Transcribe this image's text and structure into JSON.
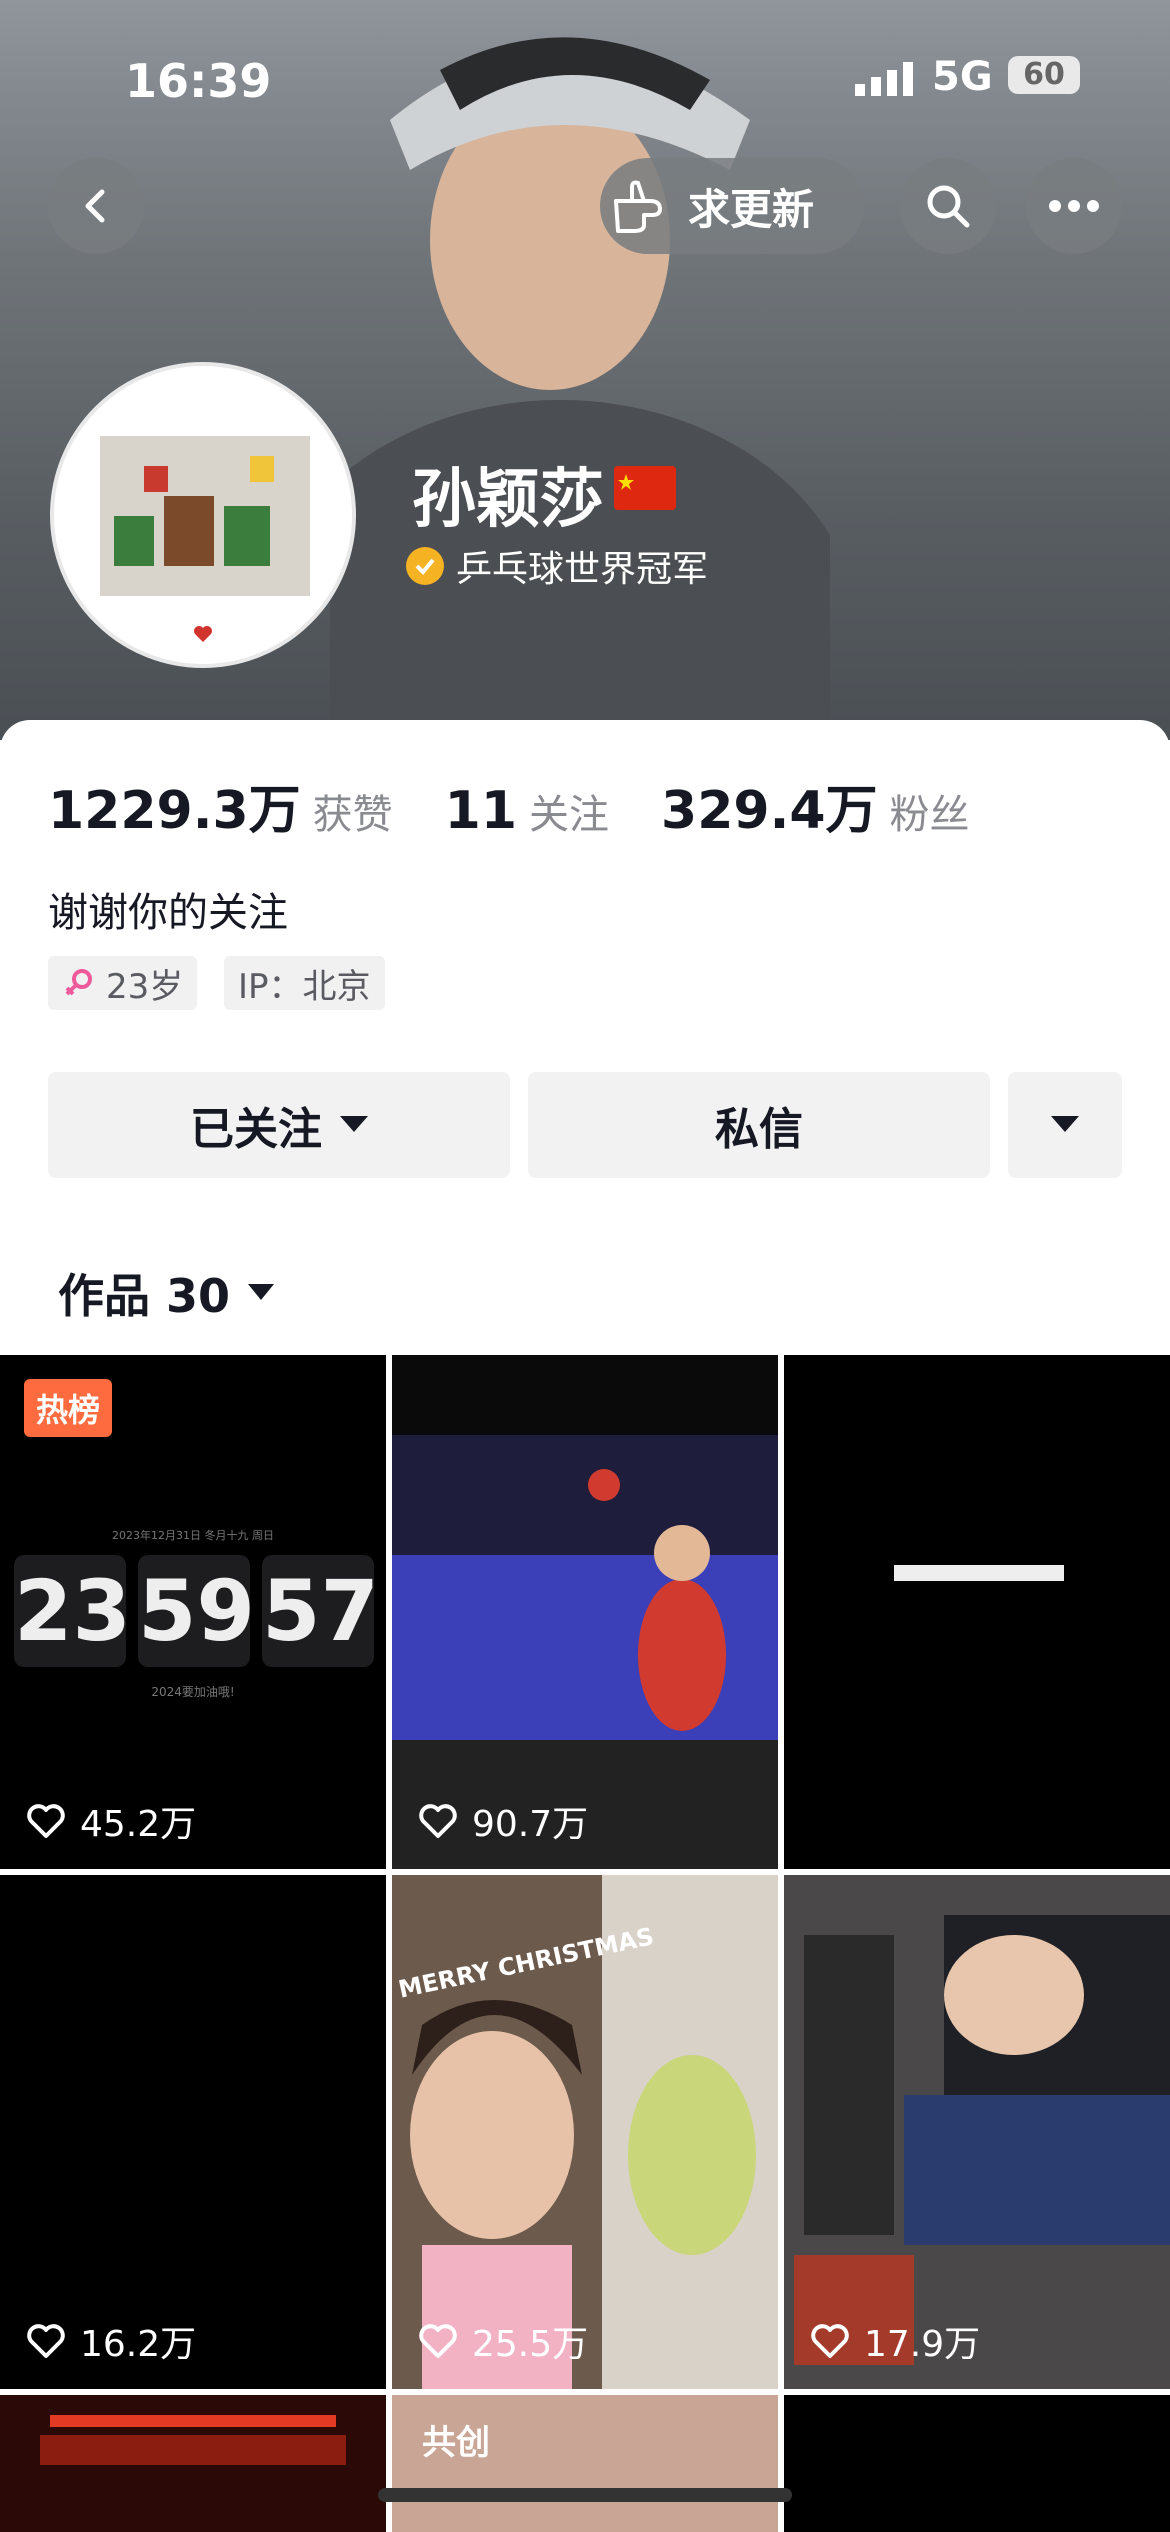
{
  "status_bar": {
    "time": "16:39",
    "network": "5G",
    "battery": "60"
  },
  "header": {
    "request_update_label": "求更新"
  },
  "profile": {
    "name": "孙颖莎",
    "verified_title": "乒乓球世界冠军",
    "bio": "谢谢你的关注",
    "tags": [
      {
        "icon": "female-icon",
        "label": "23岁"
      },
      {
        "label": "IP：北京"
      }
    ]
  },
  "stats": [
    {
      "value": "1229.3万",
      "label": "获赞"
    },
    {
      "value": "11",
      "label": "关注"
    },
    {
      "value": "329.4万",
      "label": "粉丝"
    }
  ],
  "actions": {
    "follow_label": "已关注",
    "message_label": "私信"
  },
  "works": {
    "label": "作品 30"
  },
  "grid": [
    {
      "likes": "45.2万",
      "badge": "热榜",
      "date_text": "2023年12月31日 冬月十九 周日",
      "clock": [
        "23",
        "59",
        "57"
      ],
      "caption": "2024要加油哦!"
    },
    {
      "likes": "90.7万"
    },
    {
      "likes": ""
    },
    {
      "likes": "16.2万"
    },
    {
      "likes": "25.5万",
      "sticker": "MERRY CHRISTMAS"
    },
    {
      "likes": "17.9万"
    },
    {
      "likes": ""
    },
    {
      "likes": "",
      "badge": "共创"
    },
    {
      "likes": ""
    }
  ],
  "colors": {
    "accent_hot": "#fe6b3e",
    "verify": "#f5b323",
    "flag": "#de2910"
  }
}
